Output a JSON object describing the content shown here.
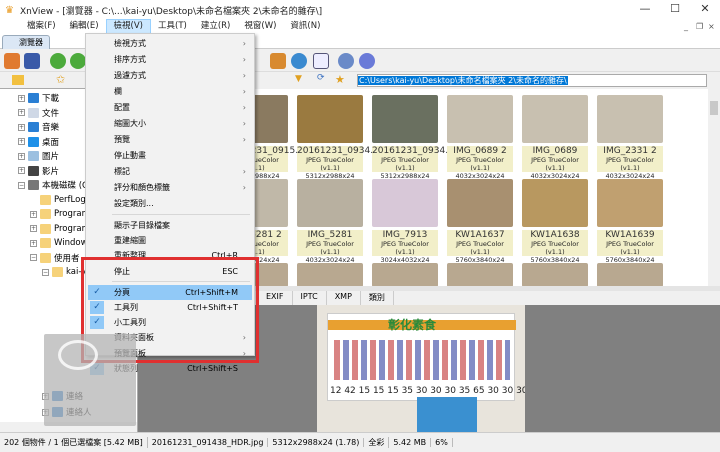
{
  "window": {
    "title": "XnView - [瀏覽器 - C:\\...\\kai-yu\\Desktop\\未命名檔案夾 2\\未命名的雜存\\]",
    "minimize": "—",
    "maximize": "☐",
    "close": "✕"
  },
  "menubar": {
    "items": [
      "檔案(F)",
      "編輯(E)",
      "檢視(V)",
      "工具(T)",
      "建立(R)",
      "視窗(W)",
      "資訊(N)"
    ],
    "active": "檢視(V)",
    "mdi": [
      "_",
      "❐",
      "×"
    ]
  },
  "tab": {
    "label": "瀏覽器"
  },
  "address": {
    "value": "C:\\Users\\kai-yu\\Desktop\\未命名檔案夾 2\\未命名的雜存\\"
  },
  "tree": {
    "items": [
      {
        "label": "下載",
        "lvl": 1,
        "c": "#2a7fd4"
      },
      {
        "label": "文件",
        "lvl": 1,
        "c": "#cfd8e6"
      },
      {
        "label": "音樂",
        "lvl": 1,
        "c": "#2a7fd4"
      },
      {
        "label": "桌面",
        "lvl": 1,
        "c": "#1e90e8"
      },
      {
        "label": "圖片",
        "lvl": 1,
        "c": "#9cc0e0"
      },
      {
        "label": "影片",
        "lvl": 1,
        "c": "#444"
      },
      {
        "label": "本機磁碟 (C:)",
        "lvl": 1,
        "c": "#777"
      },
      {
        "label": "PerfLogs",
        "lvl": 2,
        "c": "#f6d27a"
      },
      {
        "label": "Program Files",
        "lvl": 2,
        "c": "#f6d27a"
      },
      {
        "label": "Program Files (x86)",
        "lvl": 2,
        "c": "#f6d27a"
      },
      {
        "label": "Windows",
        "lvl": 2,
        "c": "#f6d27a"
      },
      {
        "label": "使用者",
        "lvl": 2,
        "c": "#f6d27a"
      },
      {
        "label": "kai-yu",
        "lvl": 3,
        "c": "#f6d27a"
      },
      {
        "label": "連絡",
        "lvl": 3,
        "c": "#2a7fd4"
      },
      {
        "label": "連絡人",
        "lvl": 3,
        "c": "#2a7fd4"
      }
    ]
  },
  "thumbnails": {
    "rows": [
      [
        {
          "name": "20161231_0915...",
          "format": "JPEG TrueColor (v1.1)",
          "dims": "5312x2988x24",
          "c": "#8a7a60"
        },
        {
          "name": "20161231_0934...",
          "format": "JPEG TrueColor (v1.1)",
          "dims": "5312x2988x24",
          "c": "#9a7a40"
        },
        {
          "name": "20161231_0934...",
          "format": "JPEG TrueColor (v1.1)",
          "dims": "5312x2988x24",
          "c": "#6a7060"
        },
        {
          "name": "IMG_0689 2",
          "format": "JPEG TrueColor (v1.1)",
          "dims": "4032x3024x24",
          "c": "#c8c0b0"
        },
        {
          "name": "IMG_0689",
          "format": "JPEG TrueColor (v1.1)",
          "dims": "4032x3024x24",
          "c": "#c8c0b0"
        },
        {
          "name": "IMG_2331 2",
          "format": "JPEG TrueColor (v1.1)",
          "dims": "4032x3024x24",
          "c": "#c8c0b0"
        }
      ],
      [
        {
          "name": "IMG_5281 2",
          "format": "JPEG TrueColor (v1.1)",
          "dims": "4032x3024x24",
          "c": "#c0b8a8"
        },
        {
          "name": "IMG_5281",
          "format": "JPEG TrueColor (v1.1)",
          "dims": "4032x3024x24",
          "c": "#b8b0a0"
        },
        {
          "name": "IMG_7913",
          "format": "JPEG TrueColor (v1.1)",
          "dims": "3024x4032x24",
          "c": "#d8c8d8"
        },
        {
          "name": "KW1A1637",
          "format": "JPEG TrueColor (v1.1)",
          "dims": "5760x3840x24",
          "c": "#a89070"
        },
        {
          "name": "KW1A1638",
          "format": "JPEG TrueColor (v1.1)",
          "dims": "5760x3840x24",
          "c": "#b89860"
        },
        {
          "name": "KW1A1639",
          "format": "JPEG TrueColor (v1.1)",
          "dims": "5760x3840x24",
          "c": "#c0a070"
        }
      ]
    ]
  },
  "info_tabs": [
    "EXIF",
    "IPTC",
    "XMP",
    "類別"
  ],
  "preview": {
    "sign_title": "彰化素食",
    "sign_prices": "12 42 15 15 15 35 30 30 30 35 65 30 30 30 20 20"
  },
  "menu": {
    "items": [
      {
        "label": "檢視方式",
        "sub": true
      },
      {
        "label": "排序方式",
        "sub": true
      },
      {
        "label": "過濾方式",
        "sub": true
      },
      {
        "label": "欄",
        "sub": true
      },
      {
        "label": "配置",
        "sub": true
      },
      {
        "label": "縮圖大小",
        "sub": true
      },
      {
        "label": "預覽",
        "sub": true
      },
      {
        "label": "停止動畫"
      },
      {
        "label": "標記",
        "sub": true
      },
      {
        "label": "評分和顏色標籤",
        "sub": true
      },
      {
        "label": "設定類別..."
      },
      {
        "sep": true
      },
      {
        "label": "顯示子目錄檔案"
      },
      {
        "label": "重建縮圖"
      },
      {
        "label": "重新整理",
        "shortcut": "Ctrl+R"
      },
      {
        "label": "停止",
        "shortcut": "ESC"
      },
      {
        "sep": true
      },
      {
        "label": "分頁",
        "shortcut": "Ctrl+Shift+M",
        "checked": true,
        "highlight": true
      },
      {
        "label": "工具列",
        "shortcut": "Ctrl+Shift+T",
        "checked": true
      },
      {
        "label": "小工具列",
        "checked": true
      },
      {
        "label": "資料夾面板",
        "sub": true
      },
      {
        "label": "預覽面板",
        "sub": true
      },
      {
        "label": "狀態列",
        "shortcut": "Ctrl+Shift+S",
        "checked": true
      }
    ]
  },
  "status": [
    "202 個物件 / 1 個已選檔案 [5.42 MB]",
    "20161231_091438_HDR.jpg",
    "5312x2988x24 (1.78)",
    "全彩",
    "5.42 MB",
    "6%"
  ],
  "colors": {
    "highlight": "#91c9f7",
    "annotation_box": "#e03030",
    "selection": "#0078d7"
  }
}
